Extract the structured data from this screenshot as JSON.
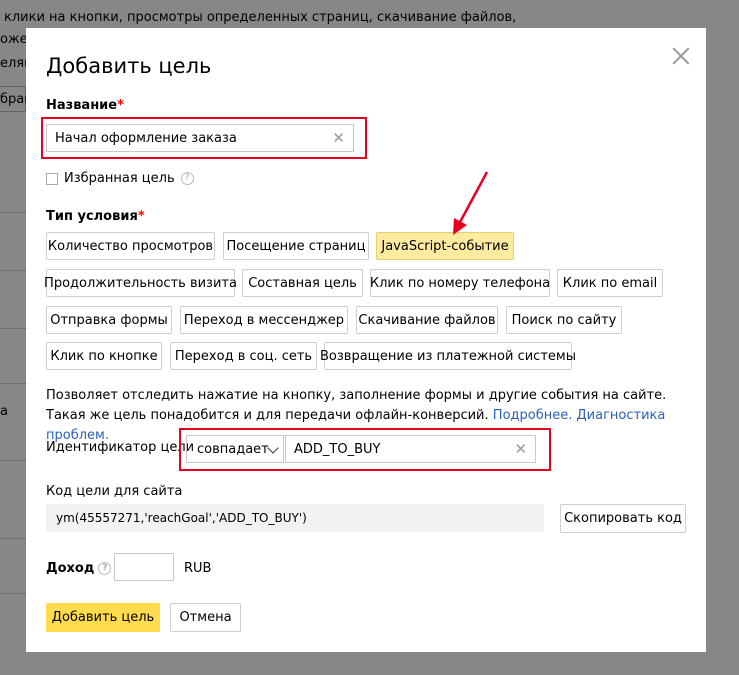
{
  "background": {
    "lines": [
      "клики на кнопки, просмотры определенных страниц, скачивание файлов,",
      "ожет",
      "елям",
      "бран",
      "а"
    ]
  },
  "modal": {
    "title": "Добавить цель",
    "name_label": "Название",
    "required_mark": "*",
    "name_value": "Начал оформление заказа",
    "favorite_label": "Избранная цель",
    "help_glyph": "?",
    "condition_label": "Тип условия",
    "condition_types": [
      "Количество просмотров",
      "Посещение страниц",
      "JavaScript-событие",
      "Продолжительность визита",
      "Составная цель",
      "Клик по номеру телефона",
      "Клик по email",
      "Отправка формы",
      "Переход в мессенджер",
      "Скачивание файлов",
      "Поиск по сайту",
      "Клик по кнопке",
      "Переход в соц. сеть",
      "Возвращение из платежной системы"
    ],
    "selected_condition": "JavaScript-событие",
    "description": "Позволяет отследить нажатие на кнопку, заполнение формы и другие события на сайте. Такая же цель понадобится и для передачи офлайн-конверсий.",
    "link_more": "Подробнее.",
    "link_diagnostics": "Диагностика проблем.",
    "identifier_label": "Идентификатор цели",
    "match_value": "совпадает",
    "identifier_value": "ADD_TO_BUY",
    "code_label": "Код цели для сайта",
    "code_value": "ym(45557271,'reachGoal','ADD_TO_BUY')",
    "copy_button": "Скопировать код",
    "income_label": "Доход",
    "income_value": "",
    "currency": "RUB",
    "submit_button": "Добавить цель",
    "cancel_button": "Отмена"
  },
  "colors": {
    "accent_yellow": "#ffdb4d",
    "selected_fill": "#ffeba0",
    "annotation_red": "#e8001f",
    "link_blue": "#2b62b8"
  }
}
